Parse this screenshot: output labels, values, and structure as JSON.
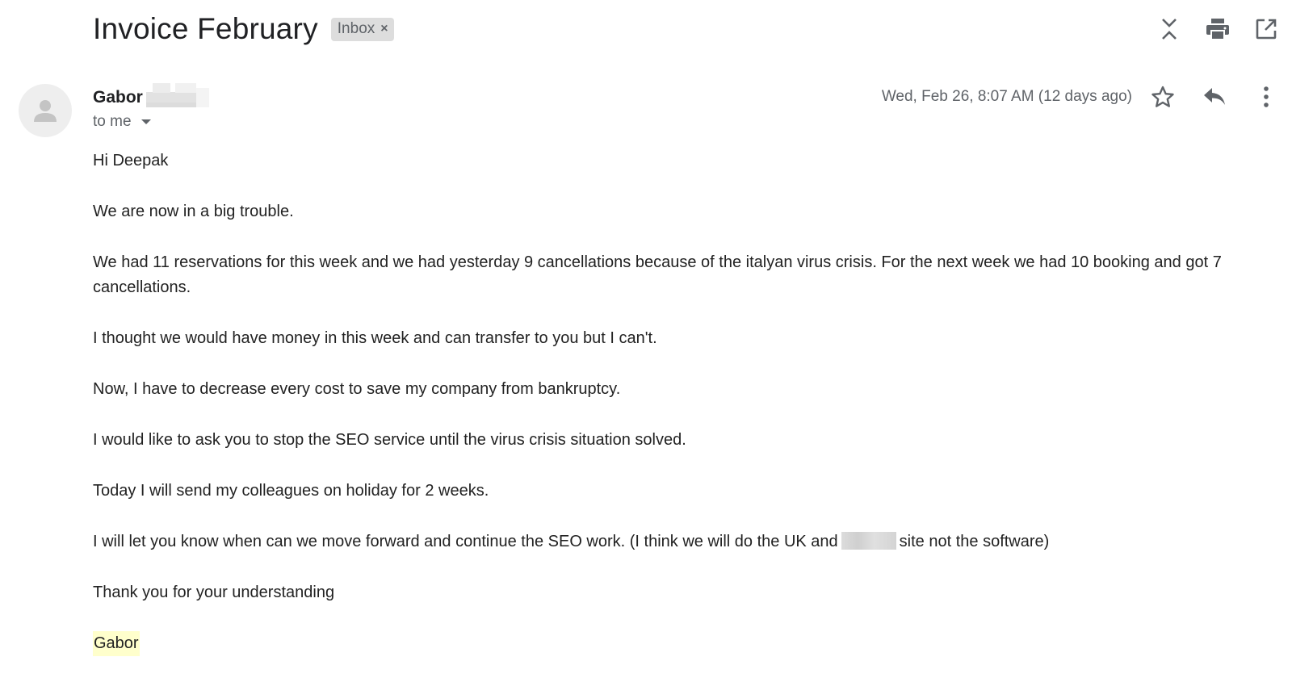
{
  "subject": "Invoice February",
  "label": {
    "text": "Inbox",
    "remove_glyph": "×"
  },
  "top_actions": [
    {
      "name": "expand-collapse-icon"
    },
    {
      "name": "print-icon"
    },
    {
      "name": "open-in-new-window-icon"
    }
  ],
  "sender": {
    "name": "Gabor",
    "recipient_label": "to me"
  },
  "date": "Wed, Feb 26, 8:07 AM (12 days ago)",
  "message_actions": [
    {
      "name": "star-icon"
    },
    {
      "name": "reply-icon"
    },
    {
      "name": "more-options-icon"
    }
  ],
  "body": {
    "greeting": "Hi Deepak",
    "p1": "We are now in a big trouble.",
    "p2": "We had 11 reservations for this week and we had yesterday 9 cancellations because of the italyan virus crisis. For the next week we had 10 booking and got 7 cancellations.",
    "p3": "I thought we would have money in this week and can transfer to you but I can't.",
    "p4": "Now, I have to decrease every cost to save my company from bankruptcy.",
    "p5": "I would like to ask you to stop the SEO service until the virus crisis situation solved.",
    "p6": "Today I will send my colleagues on holiday for 2 weeks.",
    "p7_before": "I will let you know when can we move forward and continue the SEO work. (I think we will do the UK and",
    "p7_after": "site not the software)",
    "closing": "Thank you for your understanding",
    "signature": "Gabor"
  },
  "colors": {
    "label_chip_bg": "#dddddd",
    "signature_highlight": "#ffffcc",
    "secondary_text": "#5f6368"
  }
}
